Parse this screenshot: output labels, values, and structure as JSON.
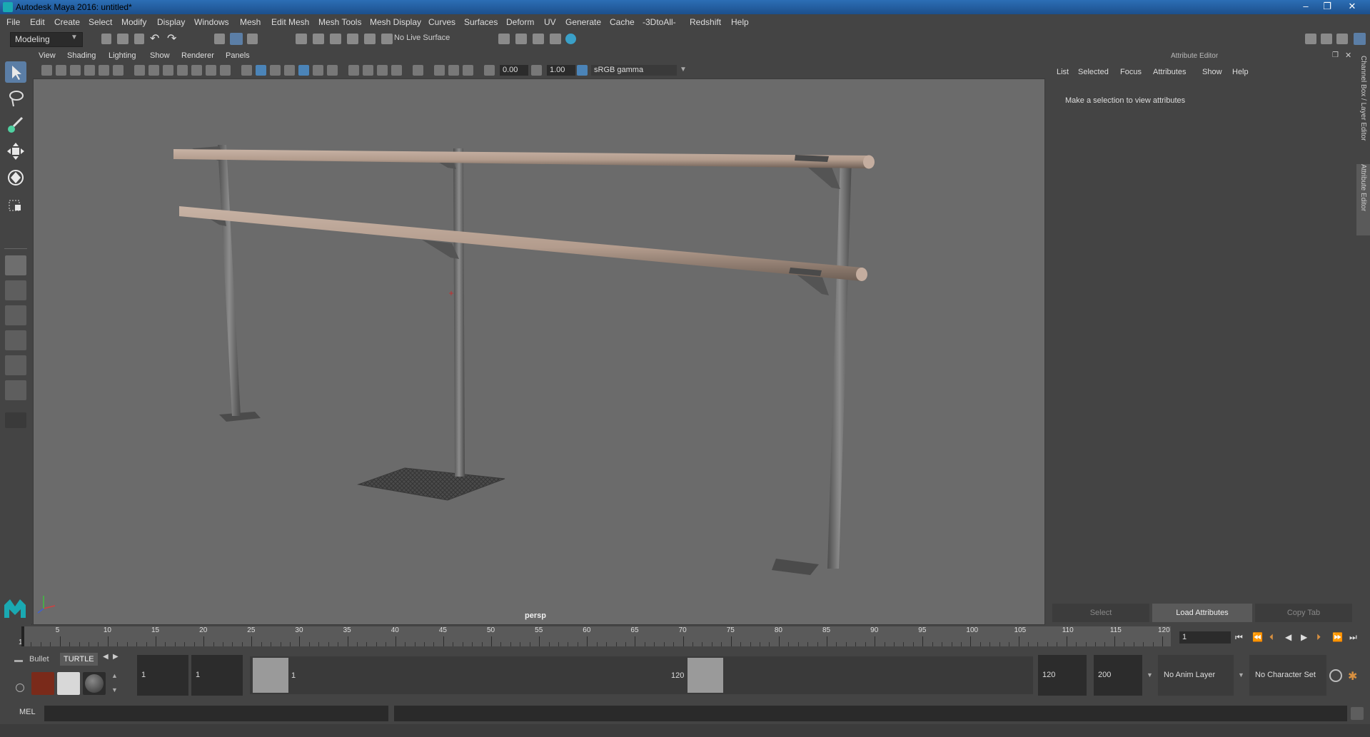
{
  "window": {
    "title": "Autodesk Maya 2016: untitled*",
    "controls": [
      "–",
      "❐",
      "✕"
    ]
  },
  "menubar": [
    "File",
    "Edit",
    "Create",
    "Select",
    "Modify",
    "Display",
    "Windows",
    "Mesh",
    "Edit Mesh",
    "Mesh Tools",
    "Mesh Display",
    "Curves",
    "Surfaces",
    "Deform",
    "UV",
    "Generate",
    "Cache",
    "-3DtoAll-",
    "Redshift",
    "Help"
  ],
  "statusline": {
    "mode": "Modeling",
    "live_surface": "No Live Surface"
  },
  "viewport": {
    "menu": [
      "View",
      "Shading",
      "Lighting",
      "Show",
      "Renderer",
      "Panels"
    ],
    "exposure": "0.00",
    "gamma": "1.00",
    "color_space": "sRGB gamma",
    "camera_label": "persp"
  },
  "attribute_editor": {
    "title": "Attribute Editor",
    "menu": [
      "List",
      "Selected",
      "Focus",
      "Attributes",
      "Show",
      "Help"
    ],
    "message": "Make a selection to view attributes",
    "buttons": [
      "Select",
      "Load Attributes",
      "Copy Tab"
    ],
    "side_tabs": [
      "Channel Box / Layer Editor",
      "Attribute Editor"
    ]
  },
  "timeline": {
    "ticks": [
      "1",
      "5",
      "10",
      "15",
      "20",
      "25",
      "30",
      "35",
      "40",
      "45",
      "50",
      "55",
      "60",
      "65",
      "70",
      "75",
      "80",
      "85",
      "90",
      "95",
      "100",
      "105",
      "110",
      "115",
      "120"
    ],
    "current_frame": "1"
  },
  "range": {
    "shelf_tabs": [
      "Bullet",
      "TURTLE"
    ],
    "start_time": "1",
    "playback_start": "1",
    "range_start_label": "1",
    "range_end_label": "120",
    "playback_end": "120",
    "end_time": "200",
    "anim_layer": "No Anim Layer",
    "character_set": "No Character Set"
  },
  "command_line": {
    "label": "MEL"
  }
}
